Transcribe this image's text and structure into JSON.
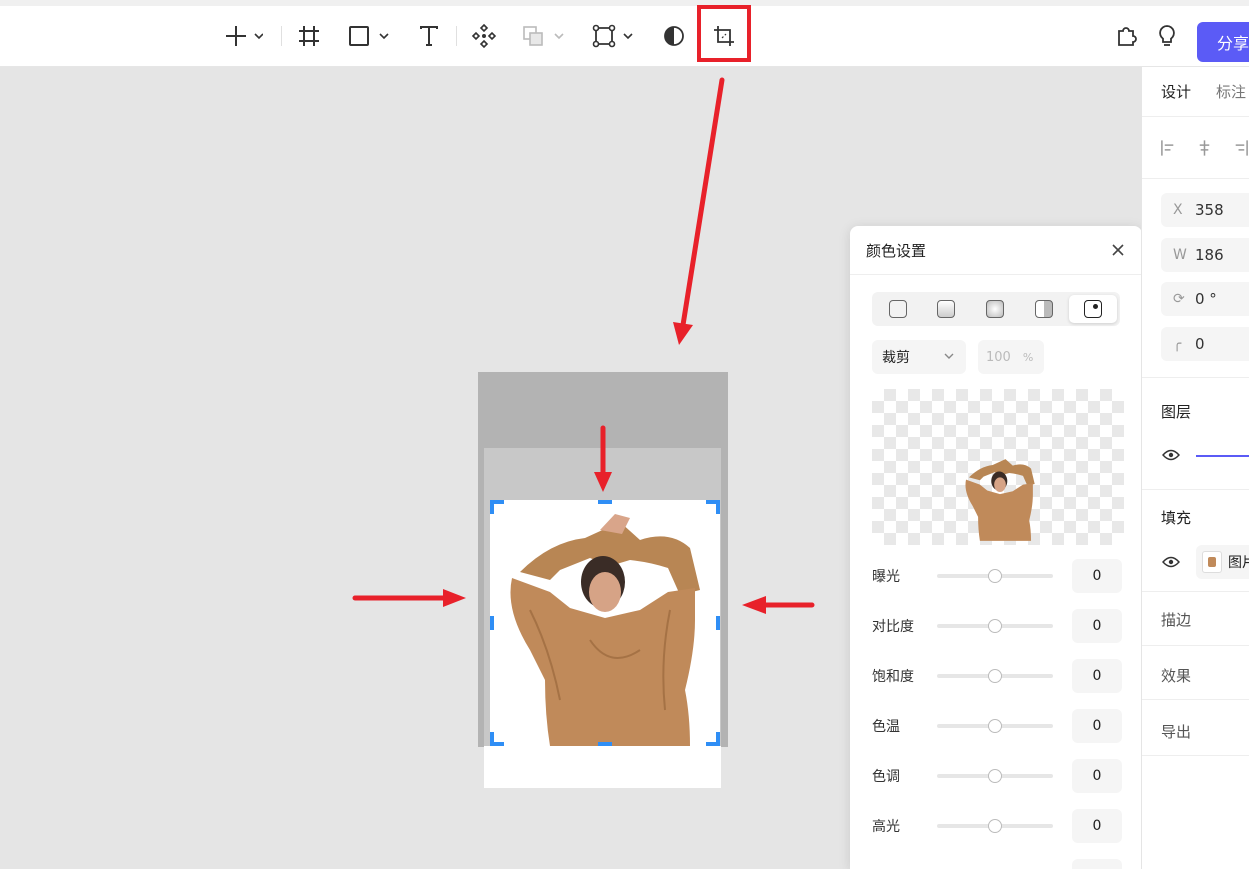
{
  "toolbar": {
    "share_label": "分享",
    "icons": [
      "plus-icon",
      "frame-icon",
      "rectangle-icon",
      "text-icon",
      "component-icon",
      "boolean-icon",
      "vector-path-icon",
      "contrast-icon",
      "crop-icon",
      "plugin-icon",
      "lightbulb-icon"
    ],
    "highlight_color": "#e8212a",
    "accent_color": "#5b5bf6"
  },
  "right_panel": {
    "tabs": [
      "设计",
      "标注"
    ],
    "x_label": "X",
    "x_value": "358",
    "w_label": "W",
    "w_value": "186",
    "rotation_value": "0 °",
    "radius_value": "0",
    "layer_title": "图层",
    "fill_title": "填充",
    "fill_item_label": "图片",
    "stroke_title": "描边",
    "effect_title": "效果",
    "export_title": "导出"
  },
  "dialog": {
    "title": "颜色设置",
    "mode_dropdown": "裁剪",
    "percent_value": "100",
    "percent_unit": "%",
    "adjustments": [
      {
        "label": "曝光",
        "value": "0",
        "level": 0.5
      },
      {
        "label": "对比度",
        "value": "0",
        "level": 0.5
      },
      {
        "label": "饱和度",
        "value": "0",
        "level": 0.5
      },
      {
        "label": "色温",
        "value": "0",
        "level": 0.5
      },
      {
        "label": "色调",
        "value": "0",
        "level": 0.5
      },
      {
        "label": "高光",
        "value": "0",
        "level": 0.5
      }
    ]
  },
  "canvas": {
    "selection_color": "#2f8ef5",
    "arrow_color": "#e8212a"
  }
}
